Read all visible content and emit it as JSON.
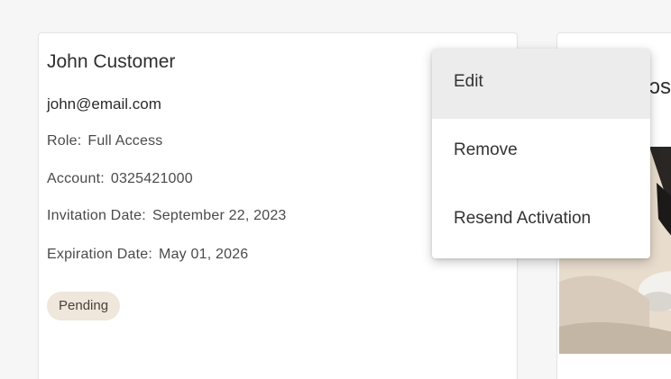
{
  "user_card": {
    "name": "John Customer",
    "email": "john@email.com",
    "role_label": "Role:",
    "role_value": "Full Access",
    "account_label": "Account:",
    "account_value": "0325421000",
    "invitation_label": "Invitation Date:",
    "invitation_value": "September 22, 2023",
    "expiration_label": "Expiration Date:",
    "expiration_value": "May 01, 2026",
    "status_badge": "Pending"
  },
  "partial_card": {
    "title_fragment": "ɔs"
  },
  "context_menu": {
    "items": [
      {
        "label": "Edit",
        "highlighted": true
      },
      {
        "label": "Remove",
        "highlighted": false
      },
      {
        "label": "Resend Activation",
        "highlighted": false
      }
    ]
  },
  "colors": {
    "page_background": "#f6f6f6",
    "card_background": "#ffffff",
    "badge_background": "#efe6dc",
    "menu_highlight": "#ececec"
  }
}
